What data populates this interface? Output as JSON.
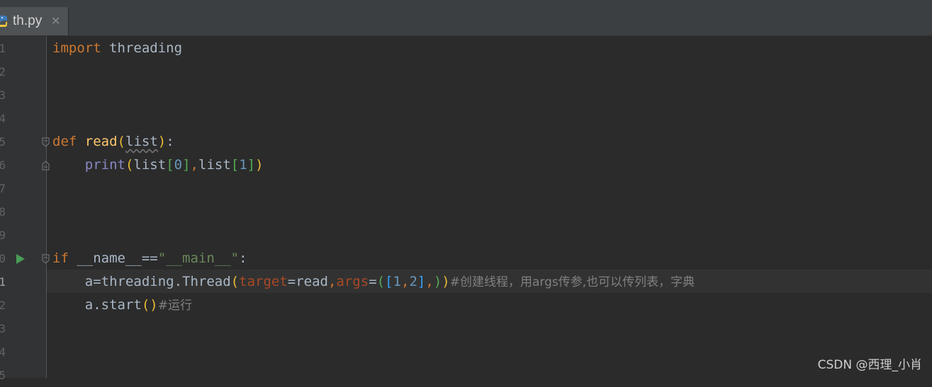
{
  "tab": {
    "filename": "th.py",
    "close_glyph": "✕",
    "icon": "python-file-icon"
  },
  "gutter": {
    "line_numbers": [
      "1",
      "2",
      "3",
      "4",
      "5",
      "6",
      "7",
      "8",
      "9",
      "0",
      "1",
      "2",
      "3",
      "4",
      "5"
    ],
    "active_line_index": 10
  },
  "code": {
    "l1": {
      "kw": "import",
      "name": "threading"
    },
    "l5": {
      "kw": "def",
      "fn": "read",
      "lp": "(",
      "param": "list",
      "rp": ")",
      "colon": ":"
    },
    "l6": {
      "builtin": "print",
      "lp": "(",
      "a": "list",
      "lb1": "[",
      "n0": "0",
      "rb1": "]",
      "comma": ",",
      "b": "list",
      "lb2": "[",
      "n1": "1",
      "rb2": "]",
      "rp": ")"
    },
    "l10": {
      "kw": "if",
      "name": " __name__==",
      "str": "\"__main__\"",
      "colon": ":"
    },
    "l11": {
      "pre": "a=threading.Thread",
      "lp": "(",
      "kw1": "target",
      "eq1": "=read",
      "c1": ",",
      "kw2": "args",
      "eq2": "=",
      "lp2": "(",
      "lb": "[",
      "n1": "1",
      "c2": ",",
      "n2": "2",
      "rb": "]",
      "c3": ",",
      "rp2": ")",
      "rp": ")",
      "comment": "#创建线程，用args传参,也可以传列表，字典"
    },
    "l12": {
      "pre": "a.start",
      "parens": "()",
      "comment": "#运行"
    }
  },
  "watermark": "CSDN @西理_小肖",
  "colors": {
    "background": "#2b2b2b",
    "keyword": "#cc7832",
    "function": "#ffc66d",
    "string": "#6a8759",
    "number": "#6897bb",
    "builtin": "#8888c6",
    "comment": "#808080",
    "run_icon": "#499c54"
  }
}
